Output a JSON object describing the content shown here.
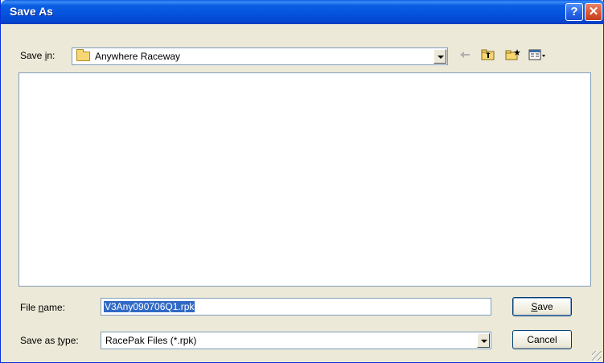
{
  "window": {
    "title": "Save As"
  },
  "titlebar": {
    "help": "?",
    "close": "✕"
  },
  "save_in": {
    "label": "Save in:",
    "mnemonic": "i",
    "value": "Anywhere Raceway"
  },
  "toolbar": {
    "back": "⇐",
    "up": "📁",
    "new_folder": "✱",
    "views": "▦▾"
  },
  "file_name": {
    "label": "File name:",
    "value": "V3Any090706Q1.rpk"
  },
  "save_type": {
    "label": "Save as type:",
    "value": "RacePak Files (*.rpk)"
  },
  "buttons": {
    "save": "Save",
    "cancel": "Cancel"
  }
}
